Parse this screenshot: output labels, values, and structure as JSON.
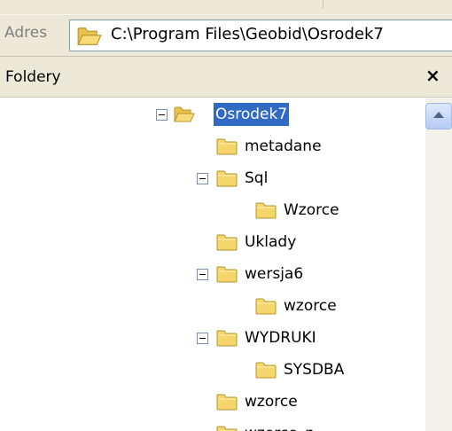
{
  "address_bar": {
    "label": "Adres",
    "path": "C:\\Program Files\\Geobid\\Osrodek7"
  },
  "folders_pane": {
    "title": "Foldery",
    "close_label": "×"
  },
  "tree": {
    "nodes": [
      {
        "label": "Osrodek7",
        "expanded": true,
        "selected": true
      },
      {
        "label": "metadane"
      },
      {
        "label": "Sql",
        "expanded": true
      },
      {
        "label": "Wzorce"
      },
      {
        "label": "Uklady"
      },
      {
        "label": "wersja6",
        "expanded": true
      },
      {
        "label": "wzorce"
      },
      {
        "label": "WYDRUKI",
        "expanded": true
      },
      {
        "label": "SYSDBA"
      },
      {
        "label": "wzorce"
      },
      {
        "label": "wzorce_n"
      }
    ]
  },
  "colors": {
    "selection": "#316ac5",
    "toolbar_bg": "#ece9d8",
    "folder_yellow": "#f5d66a"
  }
}
